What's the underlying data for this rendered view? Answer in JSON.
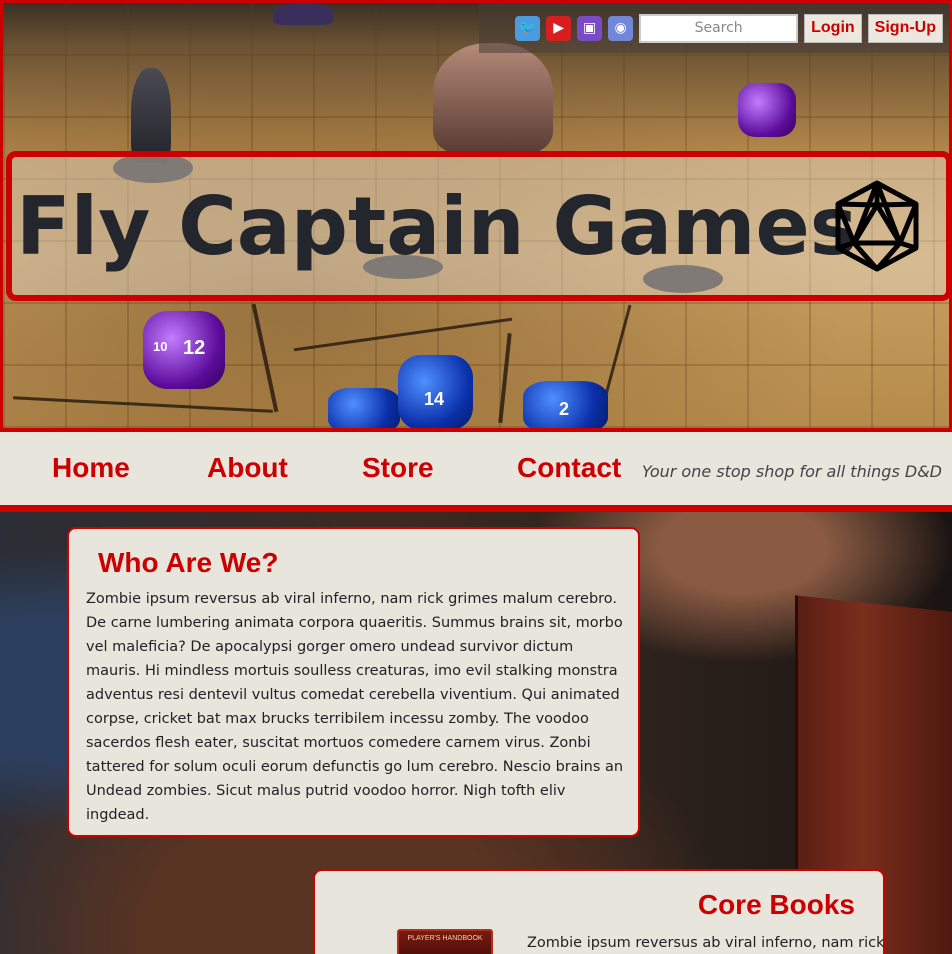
{
  "topbar": {
    "social": [
      {
        "name": "twitter-icon",
        "glyph": "🐦"
      },
      {
        "name": "youtube-icon",
        "glyph": "▶"
      },
      {
        "name": "twitch-icon",
        "glyph": "▣"
      },
      {
        "name": "discord-icon",
        "glyph": "◉"
      }
    ],
    "search_placeholder": "Search",
    "login_label": "Login",
    "signup_label": "Sign-Up"
  },
  "banner": {
    "title": "Fly Captain Games",
    "logo_icon": "d20-icon"
  },
  "nav": {
    "items": [
      "Home",
      "About",
      "Store",
      "Contact"
    ],
    "tagline": "Your one stop shop for all things D&D"
  },
  "dice_labels": [
    "12",
    "10",
    "14",
    "2"
  ],
  "who": {
    "title": "Who Are We?",
    "body": "Zombie ipsum reversus ab viral inferno, nam rick grimes malum cerebro. De carne lumbering animata corpora quaeritis. Summus brains sit, morbo vel maleficia? De apocalypsi gorger omero undead survivor dictum mauris. Hi mindless mortuis soulless creaturas, imo evil stalking monstra adventus resi dentevil vultus comedat cerebella viventium. Qui animated corpse, cricket bat max brucks terribilem incessu zomby. The voodoo sacerdos flesh eater, suscitat mortuos comedere carnem virus. Zonbi tattered for solum oculi eorum defunctis go lum cerebro. Nescio brains an Undead zombies. Sicut malus putrid voodoo horror. Nigh tofth eliv ingdead."
  },
  "core": {
    "title": "Core Books",
    "book_label": "PLAYER'S HANDBOOK",
    "body": "Zombie ipsum reversus ab viral inferno, nam rick"
  },
  "colors": {
    "accent": "#cc0000",
    "panel_bg": "#e8e5dc",
    "title_text": "#23262c"
  }
}
